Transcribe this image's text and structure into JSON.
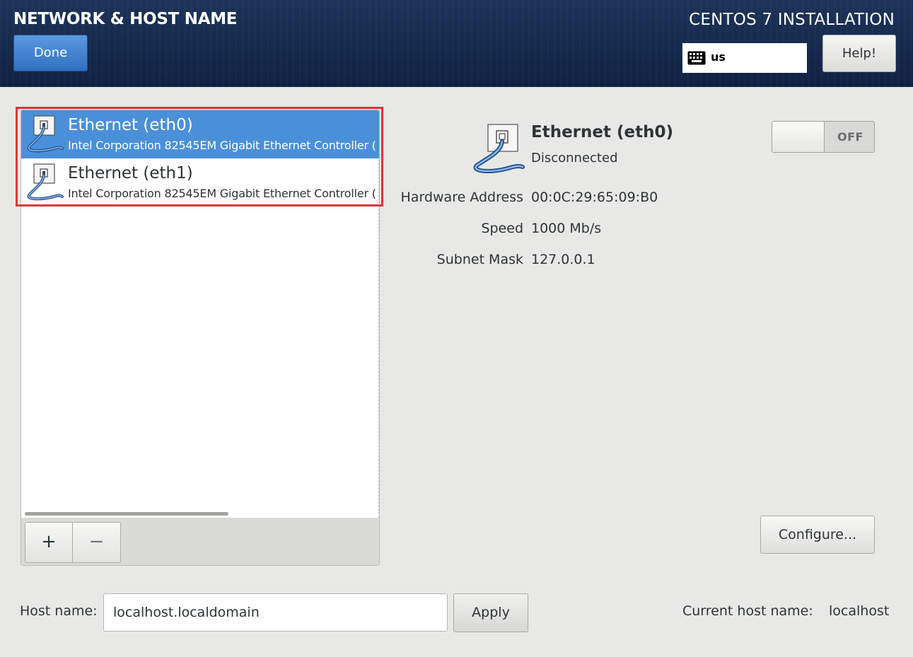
{
  "header": {
    "spoke_title": "NETWORK & HOST NAME",
    "done_label": "Done",
    "product_title": "CENTOS 7 INSTALLATION",
    "keyboard_layout": "us",
    "help_label": "Help!"
  },
  "devices": [
    {
      "name": "Ethernet (eth0)",
      "description": "Intel Corporation 82545EM Gigabit Ethernet Controller (",
      "selected": true
    },
    {
      "name": "Ethernet (eth1)",
      "description": "Intel Corporation 82545EM Gigabit Ethernet Controller (",
      "selected": false
    }
  ],
  "device_toolbar": {
    "add_label": "+",
    "remove_label": "−"
  },
  "detail": {
    "name": "Ethernet (eth0)",
    "status": "Disconnected",
    "toggle_label": "OFF",
    "properties": [
      {
        "label": "Hardware Address",
        "value": "00:0C:29:65:09:B0"
      },
      {
        "label": "Speed",
        "value": "1000 Mb/s"
      },
      {
        "label": "Subnet Mask",
        "value": "127.0.0.1"
      }
    ],
    "configure_label": "Configure..."
  },
  "hostname": {
    "label": "Host name:",
    "value": "localhost.localdomain",
    "apply_label": "Apply",
    "current_label": "Current host name:",
    "current_value": "localhost"
  },
  "colors": {
    "header_bg": "#1d3358",
    "selected_row": "#4a90d9",
    "done_button": "#3b7fd0",
    "highlight_border": "#e0353a"
  },
  "icons": {
    "device": "ethernet-cable-icon",
    "keyboard": "keyboard-icon"
  }
}
